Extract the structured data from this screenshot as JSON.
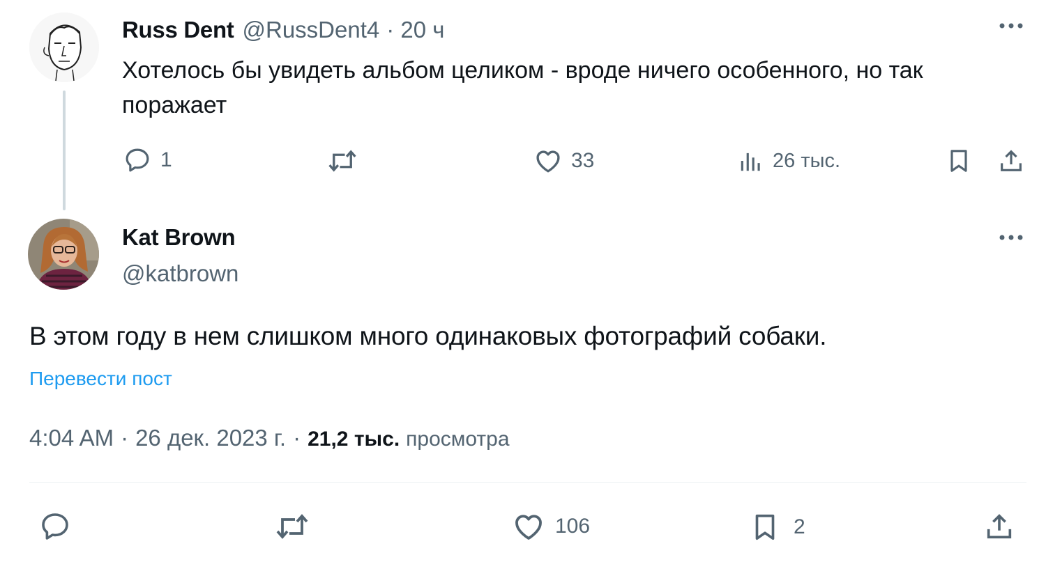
{
  "reply": {
    "name": "Russ Dent",
    "handle": "@RussDent4",
    "time": "· 20 ч",
    "text": "Хотелось бы увидеть альбом целиком - вроде ничего особенного, но так поражает",
    "actions": {
      "replies": "1",
      "reposts": "",
      "likes": "33",
      "views": "26 тыс."
    },
    "icons": [
      "reply-icon",
      "repost-icon",
      "like-icon",
      "views-icon",
      "bookmark-icon",
      "share-icon",
      "more-icon"
    ]
  },
  "main": {
    "name": "Kat Brown",
    "handle": "@katbrown",
    "text": "В этом году в нем слишком много одинаковых фотографий собаки.",
    "translate_label": "Перевести пост",
    "time": "4:04 AM",
    "date": "26 дек. 2023 г.",
    "separator": "·",
    "views_count": "21,2 тыс.",
    "views_label": "просмотра",
    "actions": {
      "replies": "",
      "reposts": "",
      "likes": "106",
      "bookmarks": "2"
    }
  },
  "colors": {
    "text": "#0f1419",
    "secondary": "#536471",
    "accent": "#1d9bf0",
    "line": "#cfd9de"
  }
}
